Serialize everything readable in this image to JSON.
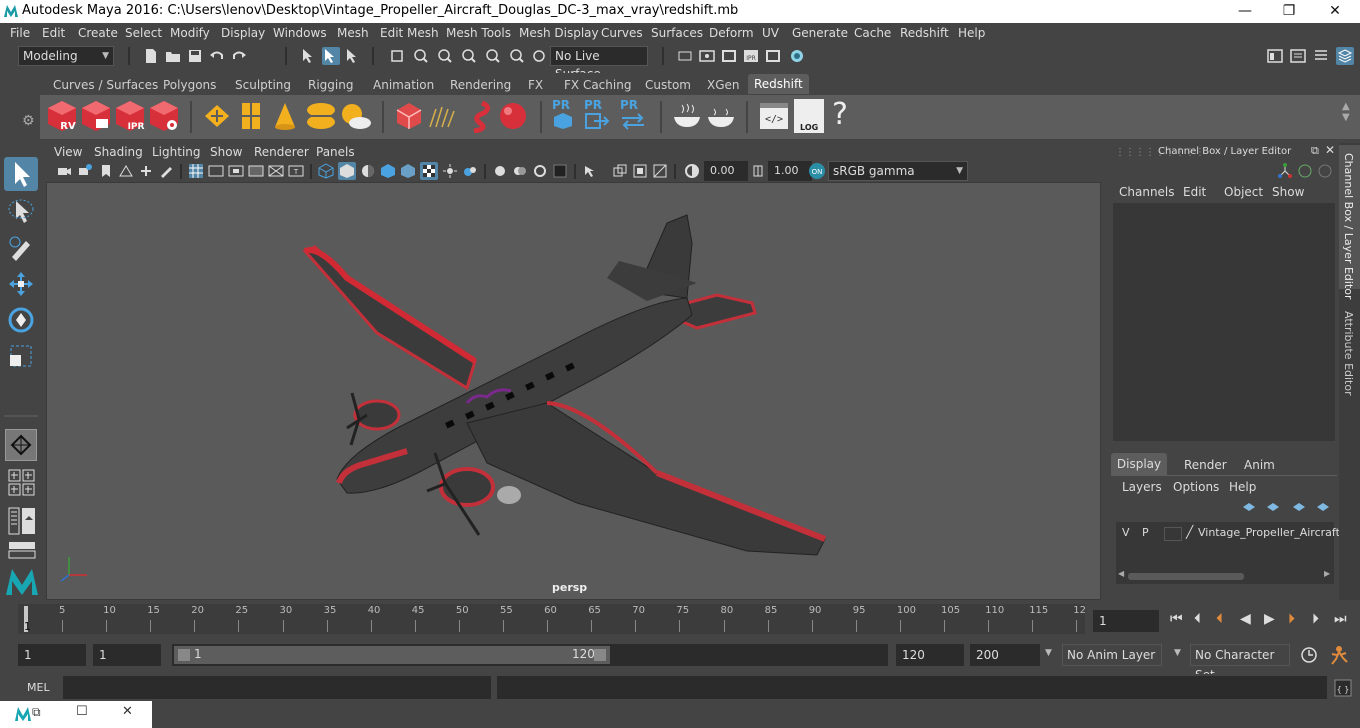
{
  "window": {
    "title": "Autodesk Maya 2016: C:\\Users\\lenov\\Desktop\\Vintage_Propeller_Aircraft_Douglas_DC-3_max_vray\\redshift.mb",
    "minimize": "—",
    "maximize": "❐",
    "close": "✕"
  },
  "menu": [
    "File",
    "Edit",
    "Create",
    "Select",
    "Modify",
    "Display",
    "Windows",
    "Mesh",
    "Edit Mesh",
    "Mesh Tools",
    "Mesh Display",
    "Curves",
    "Surfaces",
    "Deform",
    "UV",
    "Generate",
    "Cache",
    "Redshift",
    "Help"
  ],
  "statusline": {
    "mode": "Modeling",
    "live_surface": "No Live Surface"
  },
  "shelf_tabs": [
    "Curves / Surfaces",
    "Polygons",
    "Sculpting",
    "Rigging",
    "Animation",
    "Rendering",
    "FX",
    "FX Caching",
    "Custom",
    "XGen",
    "Redshift"
  ],
  "shelf_active": "Redshift",
  "shelf_icons": {
    "rv": "RV",
    "ipr": "IPR",
    "pr1": "PR",
    "pr2": "PR",
    "pr3": "PR",
    "log": "LOG",
    "help": "?"
  },
  "panel_menu": [
    "View",
    "Shading",
    "Lighting",
    "Show",
    "Renderer",
    "Panels"
  ],
  "panel_toolbar": {
    "exposure": "0.00",
    "gamma": "1.00",
    "colorspace": "sRGB gamma"
  },
  "viewport": {
    "camera_label": "persp"
  },
  "channel_box": {
    "header": "Channel Box / Layer Editor",
    "menu": [
      "Channels",
      "Edit",
      "Object",
      "Show"
    ]
  },
  "layer_editor": {
    "tabs": [
      "Display",
      "Render",
      "Anim"
    ],
    "active_tab": "Display",
    "menu": [
      "Layers",
      "Options",
      "Help"
    ],
    "layers": [
      {
        "v": "V",
        "p": "P",
        "name": "Vintage_Propeller_Aircraft"
      }
    ]
  },
  "side_tabs": [
    "Channel Box / Layer Editor",
    "Attribute Editor"
  ],
  "timeline": {
    "ticks": [
      "5",
      "10",
      "15",
      "20",
      "25",
      "30",
      "35",
      "40",
      "45",
      "50",
      "55",
      "60",
      "65",
      "70",
      "75",
      "80",
      "85",
      "90",
      "95",
      "100",
      "105",
      "110",
      "115",
      "12"
    ],
    "current_marker": "1",
    "current_frame": "1"
  },
  "range": {
    "start": "1",
    "anim_start": "1",
    "slider_start": "1",
    "slider_end": "120",
    "end": "120",
    "anim_end": "200",
    "anim_layer": "No Anim Layer",
    "character_set": "No Character Set"
  },
  "mel": {
    "label": "MEL"
  },
  "colors": {
    "bg": "#444444",
    "viewport": "#5a5a5a",
    "accent": "#5285a6",
    "redshift": "#d8303a"
  }
}
